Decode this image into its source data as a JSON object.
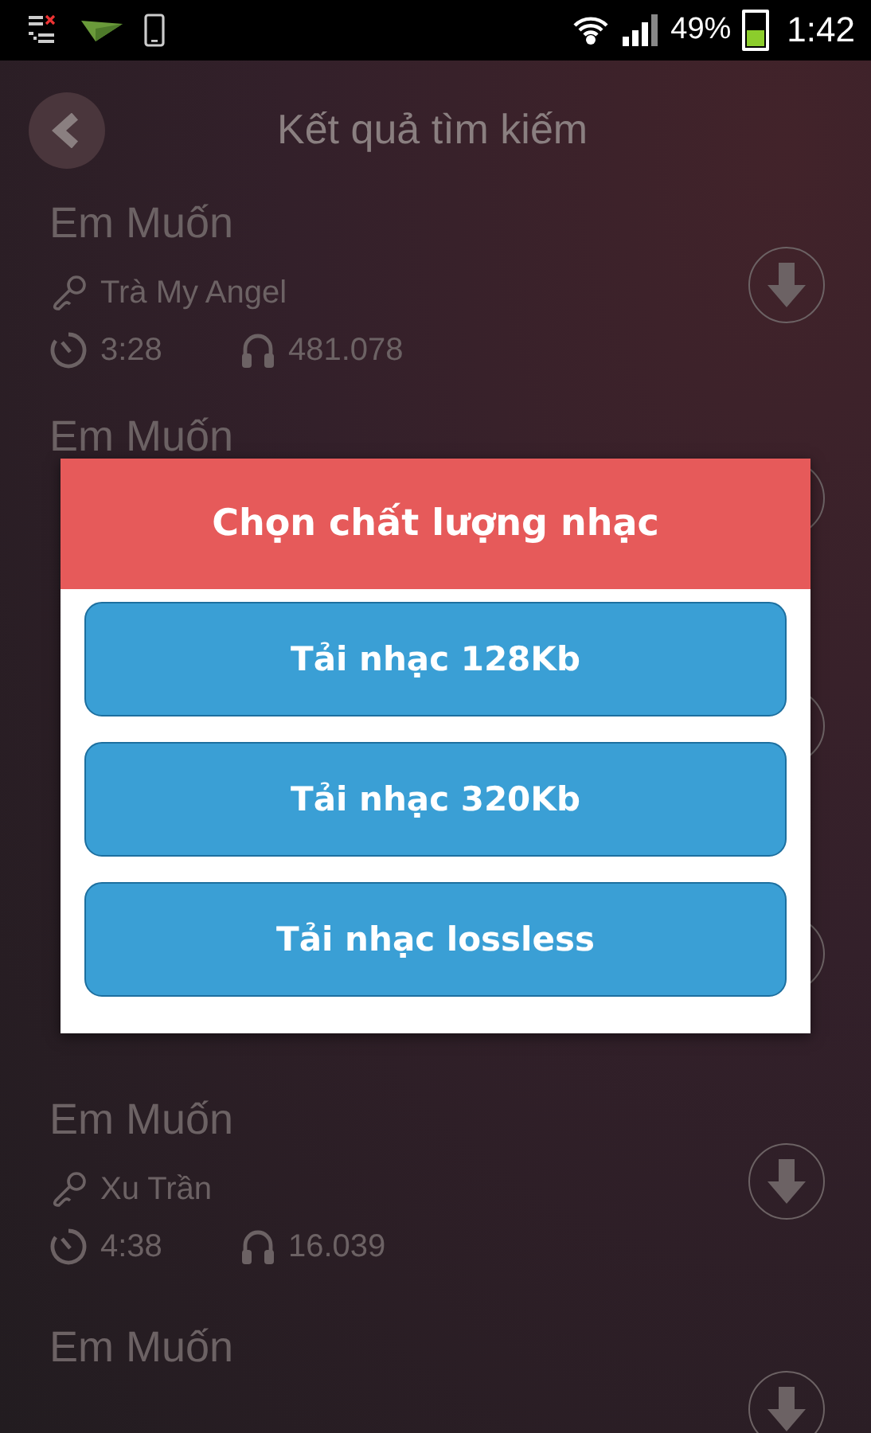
{
  "status_bar": {
    "battery_percent": "49%",
    "time": "1:42"
  },
  "header": {
    "title": "Kết quả tìm kiếm"
  },
  "songs": [
    {
      "kind": "song",
      "title": "Em Muốn",
      "artist": "Trà My Angel",
      "duration": "3:28",
      "plays": "481.078"
    },
    {
      "kind": "partial",
      "title": "Em Muốn"
    },
    {
      "kind": "covered"
    },
    {
      "kind": "covered"
    },
    {
      "kind": "song",
      "title": "Em Muốn",
      "artist": "Xu Trần",
      "duration": "4:38",
      "plays": "16.039"
    },
    {
      "kind": "song",
      "title": "Em Muốn"
    }
  ],
  "dialog": {
    "title": "Chọn chất lượng nhạc",
    "options": [
      "Tải nhạc 128Kb",
      "Tải nhạc 320Kb",
      "Tải nhạc lossless"
    ]
  }
}
